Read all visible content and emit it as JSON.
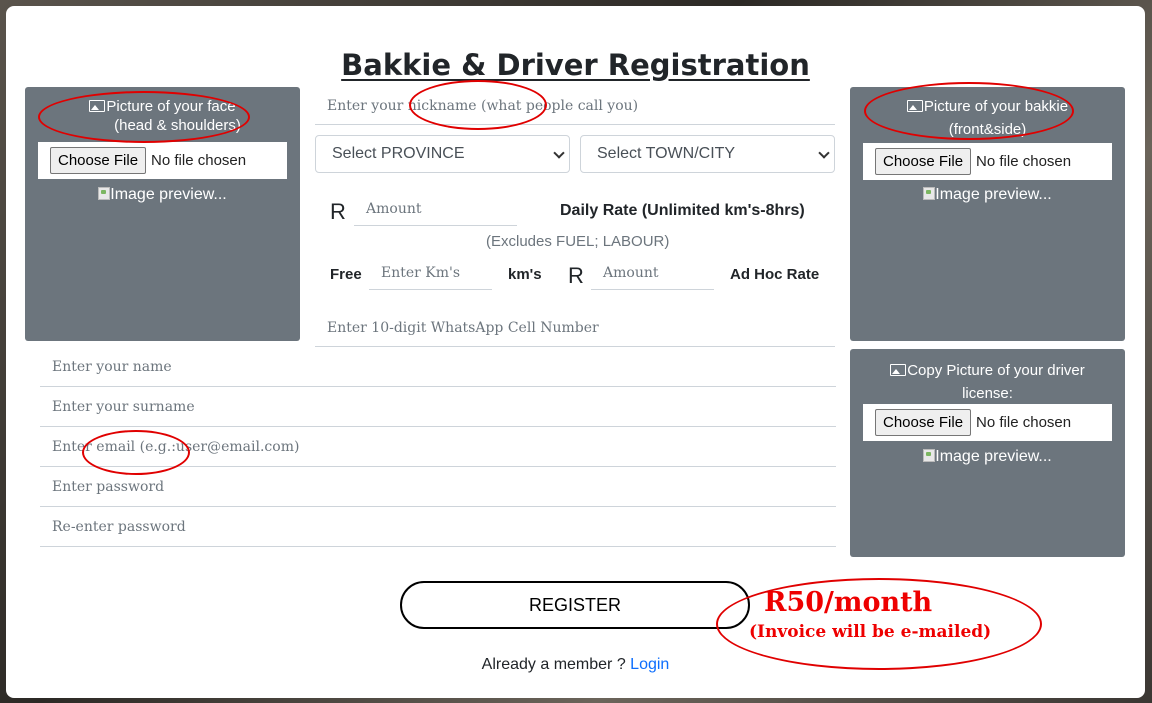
{
  "page_title": "Bakkie & Driver Registration",
  "face_panel": {
    "label_line1": "Picture of your face",
    "label_line2": "(head & shoulders)",
    "icon": "image-icon",
    "choose_file": "Choose File",
    "no_file": "No file chosen",
    "preview": "Image preview..."
  },
  "bakkie_panel": {
    "label_line1": "Picture of your bakkie",
    "label_line2": "(front&side)",
    "icon": "image-icon",
    "choose_file": "Choose File",
    "no_file": "No file chosen",
    "preview": "Image preview..."
  },
  "license_panel": {
    "label_line1": "Copy Picture of your driver",
    "label_line2": "license:",
    "icon": "image-icon",
    "choose_file": "Choose File",
    "no_file": "No file chosen",
    "preview": "Image preview..."
  },
  "nickname": {
    "placeholder": "Enter your nickname (what people call you)"
  },
  "province_select": {
    "selected": "Select PROVINCE"
  },
  "town_select": {
    "selected": "Select TOWN/CITY"
  },
  "daily_rate": {
    "currency": "R",
    "amount_placeholder": "Amount",
    "label": "Daily Rate (Unlimited km's-8hrs)",
    "note": "(Excludes FUEL; LABOUR)"
  },
  "adhoc_rate": {
    "free_label": "Free",
    "km_placeholder": "Enter Km's",
    "km_unit": "km's",
    "currency": "R",
    "amount_placeholder": "Amount",
    "label": "Ad Hoc Rate"
  },
  "whatsapp": {
    "placeholder": "Enter 10-digit WhatsApp Cell Number"
  },
  "name": {
    "placeholder": "Enter your name"
  },
  "surname": {
    "placeholder": "Enter your surname"
  },
  "email": {
    "placeholder": "Enter email (e.g.:user@email.com)"
  },
  "password": {
    "placeholder": "Enter password"
  },
  "repassword": {
    "placeholder": "Re-enter password"
  },
  "register_button": "REGISTER",
  "price": {
    "line1": "R50/month",
    "line2": "(Invoice will be e-mailed)",
    "color": "#ee0000"
  },
  "login": {
    "prompt": "Already a member ? ",
    "link": "Login",
    "link_color": "#0d6efd"
  },
  "colors": {
    "panel": "#6c757d",
    "annotation": "#e00000"
  }
}
